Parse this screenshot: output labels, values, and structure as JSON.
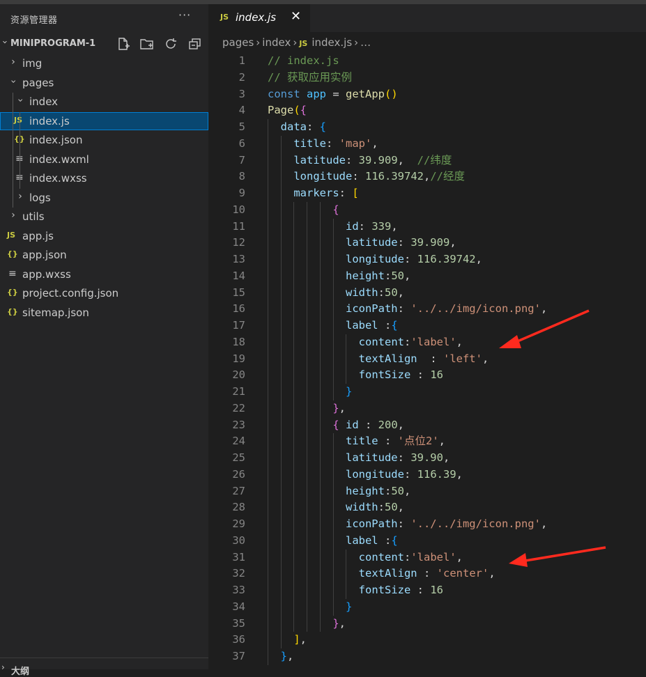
{
  "sidebar": {
    "title": "资源管理器",
    "more": "···",
    "project": "MINIPROGRAM-1",
    "tree": [
      {
        "label": "img",
        "kind": "folder",
        "open": false,
        "depth": 0
      },
      {
        "label": "pages",
        "kind": "folder",
        "open": true,
        "depth": 0
      },
      {
        "label": "index",
        "kind": "folder",
        "open": true,
        "depth": 1
      },
      {
        "label": "index.js",
        "kind": "js",
        "depth": 1,
        "selected": true
      },
      {
        "label": "index.json",
        "kind": "json",
        "depth": 1
      },
      {
        "label": "index.wxml",
        "kind": "txt",
        "depth": 1
      },
      {
        "label": "index.wxss",
        "kind": "txt",
        "depth": 1
      },
      {
        "label": "logs",
        "kind": "folder",
        "open": false,
        "depth": 1
      },
      {
        "label": "utils",
        "kind": "folder",
        "open": false,
        "depth": 0
      },
      {
        "label": "app.js",
        "kind": "js",
        "depth": 0
      },
      {
        "label": "app.json",
        "kind": "json",
        "depth": 0
      },
      {
        "label": "app.wxss",
        "kind": "txt",
        "depth": 0
      },
      {
        "label": "project.config.json",
        "kind": "json",
        "depth": 0
      },
      {
        "label": "sitemap.json",
        "kind": "json",
        "depth": 0
      }
    ],
    "outline_label": "大纲"
  },
  "icons": {
    "js": "JS",
    "json": "{}",
    "txt": "≡"
  },
  "tab": {
    "label": "index.js",
    "close": "✕"
  },
  "breadcrumb": [
    "pages",
    "index",
    "index.js",
    "…"
  ],
  "code_lines": [
    [
      [
        "cm",
        "// index.js"
      ]
    ],
    [
      [
        "cm",
        "// 获取应用实例"
      ]
    ],
    [
      [
        "kw",
        "const "
      ],
      [
        "vr",
        "app"
      ],
      [
        "op",
        " = "
      ],
      [
        "fn",
        "getApp"
      ],
      [
        "b1",
        "()"
      ]
    ],
    [
      [
        "fn",
        "Page"
      ],
      [
        "b1",
        "("
      ],
      [
        "b2",
        "{"
      ]
    ],
    [
      [
        "op",
        "  "
      ],
      [
        "pr",
        "data"
      ],
      [
        "op",
        ": "
      ],
      [
        "b3",
        "{"
      ]
    ],
    [
      [
        "op",
        "    "
      ],
      [
        "pr",
        "title"
      ],
      [
        "op",
        ": "
      ],
      [
        "st",
        "'map'"
      ],
      [
        "op",
        ","
      ]
    ],
    [
      [
        "op",
        "    "
      ],
      [
        "pr",
        "latitude"
      ],
      [
        "op",
        ": "
      ],
      [
        "nu",
        "39.909"
      ],
      [
        "op",
        ",  "
      ],
      [
        "cm",
        "//纬度"
      ]
    ],
    [
      [
        "op",
        "    "
      ],
      [
        "pr",
        "longitude"
      ],
      [
        "op",
        ": "
      ],
      [
        "nu",
        "116.39742"
      ],
      [
        "op",
        ","
      ],
      [
        "cm",
        "//经度"
      ]
    ],
    [
      [
        "op",
        "    "
      ],
      [
        "pr",
        "markers"
      ],
      [
        "op",
        ": "
      ],
      [
        "b1",
        "["
      ]
    ],
    [
      [
        "op",
        "          "
      ],
      [
        "b2",
        "{"
      ]
    ],
    [
      [
        "op",
        "            "
      ],
      [
        "pr",
        "id"
      ],
      [
        "op",
        ": "
      ],
      [
        "nu",
        "339"
      ],
      [
        "op",
        ","
      ]
    ],
    [
      [
        "op",
        "            "
      ],
      [
        "pr",
        "latitude"
      ],
      [
        "op",
        ": "
      ],
      [
        "nu",
        "39.909"
      ],
      [
        "op",
        ","
      ]
    ],
    [
      [
        "op",
        "            "
      ],
      [
        "pr",
        "longitude"
      ],
      [
        "op",
        ": "
      ],
      [
        "nu",
        "116.39742"
      ],
      [
        "op",
        ","
      ]
    ],
    [
      [
        "op",
        "            "
      ],
      [
        "pr",
        "height"
      ],
      [
        "op",
        ":"
      ],
      [
        "nu",
        "50"
      ],
      [
        "op",
        ","
      ]
    ],
    [
      [
        "op",
        "            "
      ],
      [
        "pr",
        "width"
      ],
      [
        "op",
        ":"
      ],
      [
        "nu",
        "50"
      ],
      [
        "op",
        ","
      ]
    ],
    [
      [
        "op",
        "            "
      ],
      [
        "pr",
        "iconPath"
      ],
      [
        "op",
        ": "
      ],
      [
        "st",
        "'../../img/icon.png'"
      ],
      [
        "op",
        ","
      ]
    ],
    [
      [
        "op",
        "            "
      ],
      [
        "pr",
        "label"
      ],
      [
        "op",
        " :"
      ],
      [
        "b3",
        "{"
      ]
    ],
    [
      [
        "op",
        "              "
      ],
      [
        "pr",
        "content"
      ],
      [
        "op",
        ":"
      ],
      [
        "st",
        "'label'"
      ],
      [
        "op",
        ","
      ]
    ],
    [
      [
        "op",
        "              "
      ],
      [
        "pr",
        "textAlign"
      ],
      [
        "op",
        "  : "
      ],
      [
        "st",
        "'left'"
      ],
      [
        "op",
        ","
      ]
    ],
    [
      [
        "op",
        "              "
      ],
      [
        "pr",
        "fontSize"
      ],
      [
        "op",
        " : "
      ],
      [
        "nu",
        "16"
      ]
    ],
    [
      [
        "op",
        "            "
      ],
      [
        "b3",
        "}"
      ]
    ],
    [
      [
        "op",
        "          "
      ],
      [
        "b2",
        "}"
      ],
      [
        "op",
        ","
      ]
    ],
    [
      [
        "op",
        "          "
      ],
      [
        "b2",
        "{ "
      ],
      [
        "pr",
        "id"
      ],
      [
        "op",
        " : "
      ],
      [
        "nu",
        "200"
      ],
      [
        "op",
        ","
      ]
    ],
    [
      [
        "op",
        "            "
      ],
      [
        "pr",
        "title"
      ],
      [
        "op",
        " : "
      ],
      [
        "st",
        "'点位2'"
      ],
      [
        "op",
        ","
      ]
    ],
    [
      [
        "op",
        "            "
      ],
      [
        "pr",
        "latitude"
      ],
      [
        "op",
        ": "
      ],
      [
        "nu",
        "39.90"
      ],
      [
        "op",
        ","
      ]
    ],
    [
      [
        "op",
        "            "
      ],
      [
        "pr",
        "longitude"
      ],
      [
        "op",
        ": "
      ],
      [
        "nu",
        "116.39"
      ],
      [
        "op",
        ","
      ]
    ],
    [
      [
        "op",
        "            "
      ],
      [
        "pr",
        "height"
      ],
      [
        "op",
        ":"
      ],
      [
        "nu",
        "50"
      ],
      [
        "op",
        ","
      ]
    ],
    [
      [
        "op",
        "            "
      ],
      [
        "pr",
        "width"
      ],
      [
        "op",
        ":"
      ],
      [
        "nu",
        "50"
      ],
      [
        "op",
        ","
      ]
    ],
    [
      [
        "op",
        "            "
      ],
      [
        "pr",
        "iconPath"
      ],
      [
        "op",
        ": "
      ],
      [
        "st",
        "'../../img/icon.png'"
      ],
      [
        "op",
        ","
      ]
    ],
    [
      [
        "op",
        "            "
      ],
      [
        "pr",
        "label"
      ],
      [
        "op",
        " :"
      ],
      [
        "b3",
        "{"
      ]
    ],
    [
      [
        "op",
        "              "
      ],
      [
        "pr",
        "content"
      ],
      [
        "op",
        ":"
      ],
      [
        "st",
        "'label'"
      ],
      [
        "op",
        ","
      ]
    ],
    [
      [
        "op",
        "              "
      ],
      [
        "pr",
        "textAlign"
      ],
      [
        "op",
        " : "
      ],
      [
        "st",
        "'center'"
      ],
      [
        "op",
        ","
      ]
    ],
    [
      [
        "op",
        "              "
      ],
      [
        "pr",
        "fontSize"
      ],
      [
        "op",
        " : "
      ],
      [
        "nu",
        "16"
      ]
    ],
    [
      [
        "op",
        "            "
      ],
      [
        "b3",
        "}"
      ]
    ],
    [
      [
        "op",
        "          "
      ],
      [
        "b2",
        "}"
      ],
      [
        "op",
        ","
      ]
    ],
    [
      [
        "op",
        "    "
      ],
      [
        "b1",
        "]"
      ],
      [
        "op",
        ","
      ]
    ],
    [
      [
        "op",
        "  "
      ],
      [
        "b3",
        "}"
      ],
      [
        "op",
        ","
      ]
    ]
  ],
  "line_numbers": [
    "1",
    "2",
    "3",
    "4",
    "5",
    "6",
    "7",
    "8",
    "9",
    "10",
    "11",
    "12",
    "13",
    "14",
    "15",
    "16",
    "17",
    "18",
    "19",
    "20",
    "21",
    "22",
    "23",
    "24",
    "25",
    "26",
    "27",
    "28",
    "29",
    "30",
    "31",
    "32",
    "33",
    "34",
    "35",
    "36",
    "37"
  ],
  "annotation_color": "#ff2a1e"
}
